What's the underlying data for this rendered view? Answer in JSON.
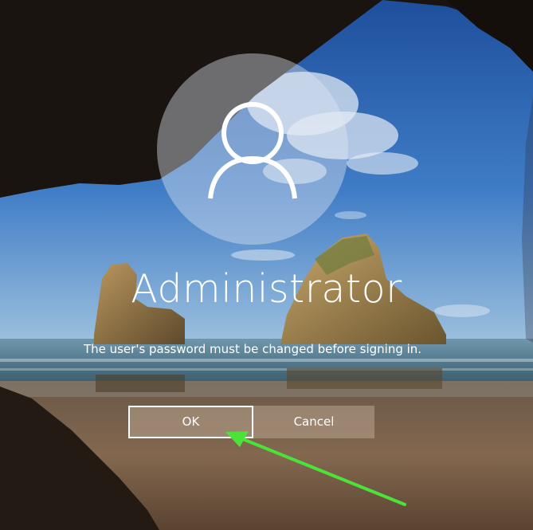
{
  "login": {
    "username": "Administrator",
    "message": "The user's password must be changed before signing in.",
    "ok_label": "OK",
    "cancel_label": "Cancel"
  },
  "avatar_icon": "user-silhouette-icon",
  "annotation": {
    "icon": "green-pointer-arrow",
    "color": "#4be23a"
  },
  "colors": {
    "button_bg": "rgba(200,180,160,0.45)",
    "text": "#ffffff",
    "focus_border": "#ffffff"
  }
}
